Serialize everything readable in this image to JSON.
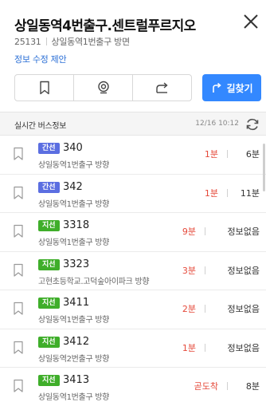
{
  "header": {
    "title": "상일동역4번출구.센트럴푸르지오",
    "stop_id": "25131",
    "stop_desc": "상일동역1번출구 방면",
    "edit_link": "정보 수정 제안",
    "route_label": "길찾기"
  },
  "realtime": {
    "title": "실시간 버스정보",
    "time": "12/16 10:12"
  },
  "buses": [
    {
      "type": "간선",
      "number": "340",
      "direction": "상일동역1번출구 방향",
      "arrive1": "1분",
      "arrive2": "6분"
    },
    {
      "type": "간선",
      "number": "342",
      "direction": "상일동역1번출구 방향",
      "arrive1": "1분",
      "arrive2": "11분"
    },
    {
      "type": "지선",
      "number": "3318",
      "direction": "상일동역1번출구 방향",
      "arrive1": "9분",
      "arrive2": "정보없음"
    },
    {
      "type": "지선",
      "number": "3323",
      "direction": "고현초등학교.고덕숲아이파크 방향",
      "arrive1": "3분",
      "arrive2": "정보없음"
    },
    {
      "type": "지선",
      "number": "3411",
      "direction": "상일동역1번출구 방향",
      "arrive1": "2분",
      "arrive2": "정보없음"
    },
    {
      "type": "지선",
      "number": "3412",
      "direction": "상일동역2번출구 방향",
      "arrive1": "1분",
      "arrive2": "정보없음"
    },
    {
      "type": "지선",
      "number": "3413",
      "direction": "상일동역1번출구 방향",
      "arrive1": "곧도착",
      "arrive2": "8분"
    }
  ],
  "colors": {
    "accent": "#3388ff",
    "trunk_badge": "#5b6ee1",
    "branch_badge": "#3fae2a",
    "arrival": "#e5493a"
  },
  "icons": {
    "close": "close-icon",
    "bookmark": "bookmark-icon",
    "streetview": "streetview-icon",
    "share": "share-icon",
    "route": "route-icon",
    "refresh": "refresh-icon",
    "favorite": "bookmark-icon"
  }
}
